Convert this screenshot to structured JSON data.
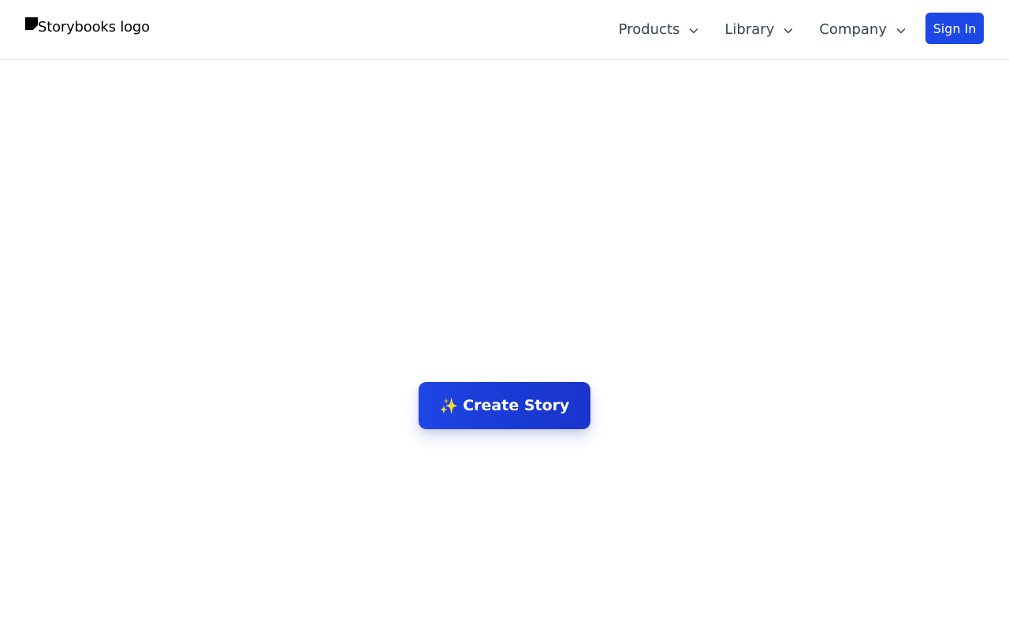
{
  "header": {
    "logo_alt": "Storybooks logo",
    "nav": [
      {
        "label": "Products"
      },
      {
        "label": "Library"
      },
      {
        "label": "Company"
      }
    ],
    "signin_label": "Sign In"
  },
  "hero": {
    "cta_icon": "✨",
    "cta_label": "Create Story"
  },
  "colors": {
    "accent": "#1e48e5",
    "nav_text": "#374151"
  }
}
